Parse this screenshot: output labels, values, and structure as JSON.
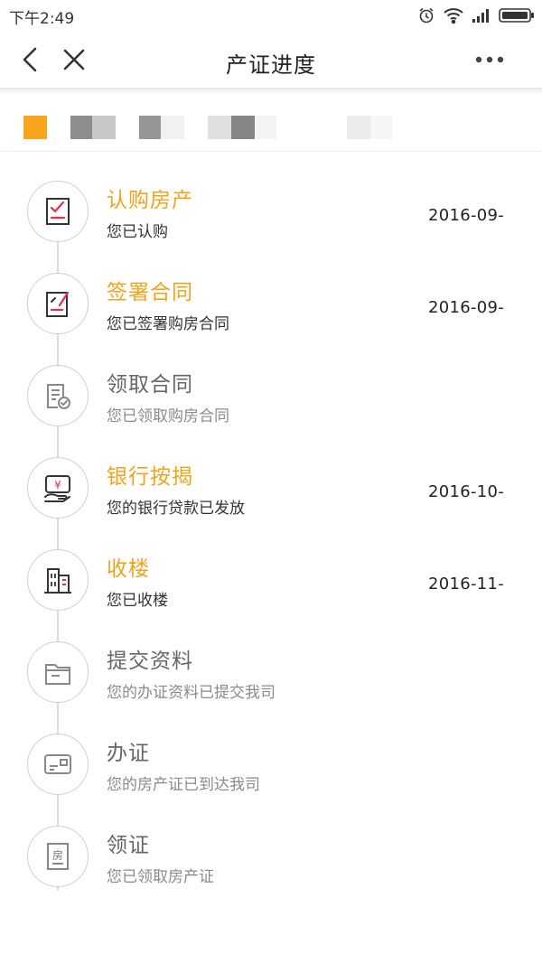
{
  "status_bar": {
    "time": "下午2:49",
    "icons": [
      "alarm-icon",
      "wifi-icon",
      "signal-icon",
      "battery-icon"
    ]
  },
  "nav": {
    "title": "产证进度",
    "back_icon": "chevron-left-icon",
    "close_icon": "close-icon",
    "more_icon": "more-dots-icon"
  },
  "colors": {
    "accent": "#f0a31c",
    "done_icon_stroke": "#333333",
    "icon_red": "#e0314b",
    "todo_icon_stroke": "#888888"
  },
  "steps": [
    {
      "title": "认购房产",
      "desc": "您已认购",
      "date": "2016-09-",
      "status": "done",
      "icon": "subscribe-checklist-icon"
    },
    {
      "title": "签署合同",
      "desc": "您已签署购房合同",
      "date": "2016-09-",
      "status": "done",
      "icon": "sign-contract-icon"
    },
    {
      "title": "领取合同",
      "desc": "您已领取购房合同",
      "date": "",
      "status": "todo",
      "icon": "receive-contract-icon"
    },
    {
      "title": "银行按揭",
      "desc": "您的银行贷款已发放",
      "date": "2016-10-",
      "status": "done",
      "icon": "bank-mortgage-icon"
    },
    {
      "title": "收楼",
      "desc": "您已收楼",
      "date": "2016-11-",
      "status": "done",
      "icon": "building-icon"
    },
    {
      "title": "提交资料",
      "desc": "您的办证资料已提交我司",
      "date": "",
      "status": "todo",
      "icon": "folder-icon"
    },
    {
      "title": "办证",
      "desc": "您的房产证已到达我司",
      "date": "",
      "status": "todo",
      "icon": "id-card-icon"
    },
    {
      "title": "领证",
      "desc": "您已领取房产证",
      "date": "",
      "status": "todo",
      "icon": "house-certificate-icon"
    }
  ],
  "certificate_icon_char": "房"
}
